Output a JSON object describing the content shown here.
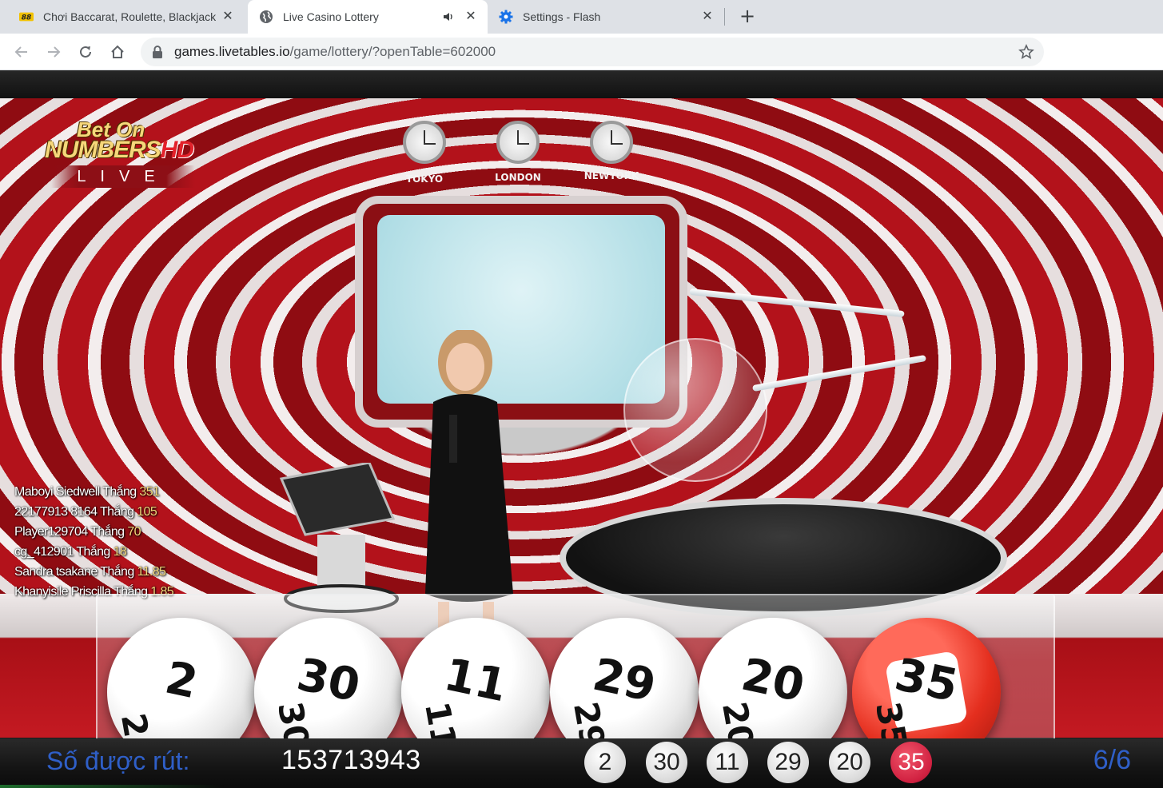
{
  "browser": {
    "tabs": [
      {
        "title": "Chơi Baccarat, Roulette, Blackjack",
        "favicon": "baccarat-88-icon",
        "active": false
      },
      {
        "title": "Live Casino Lottery",
        "favicon": "globe-icon",
        "active": true,
        "audio": true
      },
      {
        "title": "Settings - Flash",
        "favicon": "gear-icon",
        "active": false
      }
    ],
    "url_host": "games.livetables.io",
    "url_path": "/game/lottery/?openTable=602000"
  },
  "stream": {
    "logo": {
      "line1": "Bet On",
      "line2_main": "NUMBERS",
      "line2_suffix": "HD",
      "line3": "LIVE"
    },
    "clocks": [
      "TOKYO",
      "LONDON",
      "NEWYORK"
    ]
  },
  "winners": [
    {
      "name": "Maboyi Siedwell",
      "word": "Thắng",
      "amount": "351"
    },
    {
      "name": "22177913 8164",
      "word": "Thắng",
      "amount": "105"
    },
    {
      "name": "Player129704",
      "word": "Thắng",
      "amount": "70"
    },
    {
      "name": "cg_412901",
      "word": "Thắng",
      "amount": "18"
    },
    {
      "name": "Sandra tsakane",
      "word": "Thắng",
      "amount": "11.85"
    },
    {
      "name": "Khanyisile Priscilla",
      "word": "Thắng",
      "amount": "1.85"
    }
  ],
  "drawn_balls": [
    "2",
    "30",
    "11",
    "29",
    "20",
    "35"
  ],
  "bottom": {
    "drawn_label": "Số được rút:",
    "draw_id": "153713943",
    "count": "6/6"
  },
  "colors": {
    "accent_blue": "#2f5fc8",
    "highlight_ball": "#d02040",
    "studio_red": "#b3121b"
  }
}
